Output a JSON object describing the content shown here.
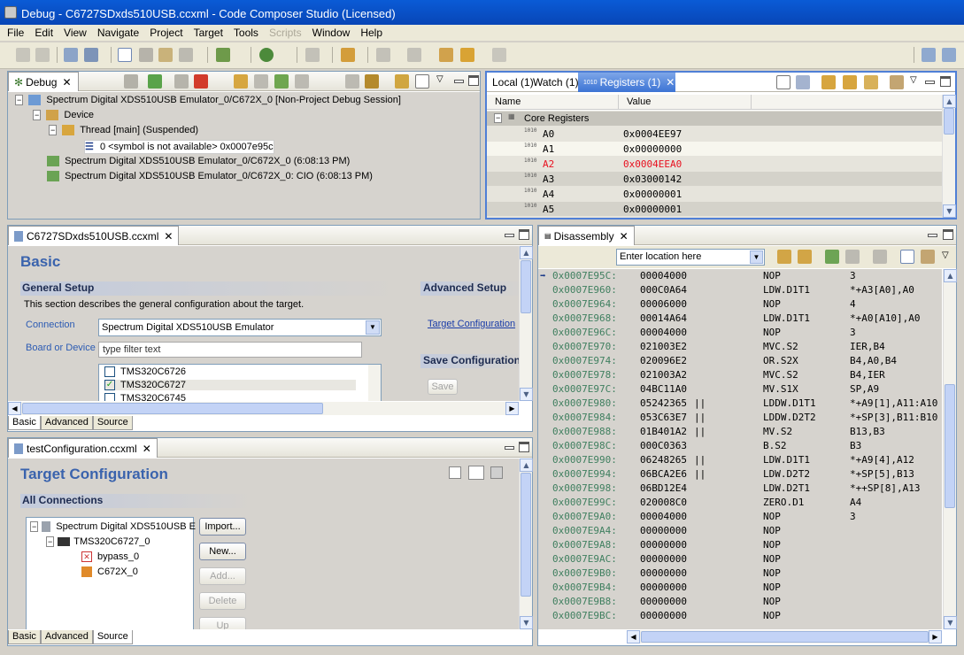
{
  "window": {
    "title": "Debug - C6727SDxds510USB.ccxml - Code Composer Studio (Licensed)"
  },
  "menu": [
    "File",
    "Edit",
    "View",
    "Navigate",
    "Project",
    "Target",
    "Tools",
    "Scripts",
    "Window",
    "Help"
  ],
  "debug_view": {
    "tab": "Debug",
    "items": [
      "Spectrum Digital XDS510USB Emulator_0/C672X_0 [Non-Project Debug Session]",
      "Device",
      "Thread [main] (Suspended)",
      "0 <symbol is not available> 0x0007e95c",
      "Spectrum Digital XDS510USB Emulator_0/C672X_0 (6:08:13 PM)",
      "Spectrum Digital XDS510USB Emulator_0/C672X_0: CIO (6:08:13 PM)"
    ]
  },
  "registers_view": {
    "tabs": [
      "Local (1)",
      "Watch (1)",
      "Registers (1)"
    ],
    "col_name": "Name",
    "col_value": "Value",
    "group": "Core Registers",
    "rows": [
      {
        "name": "A0",
        "value": "0x0004EE97",
        "changed": false
      },
      {
        "name": "A1",
        "value": "0x00000000",
        "changed": false
      },
      {
        "name": "A2",
        "value": "0x0004EEA0",
        "changed": true
      },
      {
        "name": "A3",
        "value": "0x03000142",
        "changed": false
      },
      {
        "name": "A4",
        "value": "0x00000001",
        "changed": false
      },
      {
        "name": "A5",
        "value": "0x00000001",
        "changed": false
      }
    ]
  },
  "ccxml_editor": {
    "tab": "C6727SDxds510USB.ccxml",
    "heading": "Basic",
    "general_setup": "General Setup",
    "general_desc": "This section describes the general configuration about the target.",
    "connection_label": "Connection",
    "connection_value": "Spectrum Digital XDS510USB Emulator",
    "board_label": "Board or Device",
    "filter_placeholder": "type filter text",
    "devices": [
      {
        "name": "TMS320C6726",
        "checked": false
      },
      {
        "name": "TMS320C6727",
        "checked": true
      },
      {
        "name": "TMS320C6745",
        "checked": false
      }
    ],
    "advanced_setup": "Advanced Setup",
    "target_config_link": "Target Configuration",
    "save_config": "Save Configuration",
    "save_button": "Save",
    "bottom_tabs": [
      "Basic",
      "Advanced",
      "Source"
    ]
  },
  "test_config": {
    "tab": "testConfiguration.ccxml",
    "heading": "Target Configuration",
    "all_connections": "All Connections",
    "tree": [
      "Spectrum Digital XDS510USB E",
      "TMS320C6727_0",
      "bypass_0",
      "C672X_0"
    ],
    "buttons": [
      "Import...",
      "New...",
      "Add...",
      "Delete",
      "Up"
    ],
    "bottom_tabs": [
      "Basic",
      "Advanced",
      "Source"
    ]
  },
  "disassembly": {
    "tab": "Disassembly",
    "location_placeholder": "Enter location here",
    "rows": [
      {
        "addr": "0x0007E95C:",
        "code": "00004000",
        "par": "",
        "op": "NOP",
        "args": "3",
        "current": true
      },
      {
        "addr": "0x0007E960:",
        "code": "000C0A64",
        "par": "",
        "op": "LDW.D1T1",
        "args": "*+A3[A0],A0"
      },
      {
        "addr": "0x0007E964:",
        "code": "00006000",
        "par": "",
        "op": "NOP",
        "args": "4"
      },
      {
        "addr": "0x0007E968:",
        "code": "00014A64",
        "par": "",
        "op": "LDW.D1T1",
        "args": "*+A0[A10],A0"
      },
      {
        "addr": "0x0007E96C:",
        "code": "00004000",
        "par": "",
        "op": "NOP",
        "args": "3"
      },
      {
        "addr": "0x0007E970:",
        "code": "021003E2",
        "par": "",
        "op": "MVC.S2",
        "args": "IER,B4"
      },
      {
        "addr": "0x0007E974:",
        "code": "020096E2",
        "par": "",
        "op": "OR.S2X",
        "args": "B4,A0,B4"
      },
      {
        "addr": "0x0007E978:",
        "code": "021003A2",
        "par": "",
        "op": "MVC.S2",
        "args": "B4,IER"
      },
      {
        "addr": "0x0007E97C:",
        "code": "04BC11A0",
        "par": "",
        "op": "MV.S1X",
        "args": "SP,A9"
      },
      {
        "addr": "0x0007E980:",
        "code": "05242365",
        "par": "||",
        "op": "LDDW.D1T1",
        "args": "*+A9[1],A11:A10"
      },
      {
        "addr": "0x0007E984:",
        "code": "053C63E7",
        "par": "||",
        "op": "LDDW.D2T2",
        "args": "*+SP[3],B11:B10"
      },
      {
        "addr": "0x0007E988:",
        "code": "01B401A2",
        "par": "||",
        "op": "MV.S2",
        "args": "B13,B3"
      },
      {
        "addr": "0x0007E98C:",
        "code": "000C0363",
        "par": "",
        "op": "B.S2",
        "args": "B3"
      },
      {
        "addr": "0x0007E990:",
        "code": "06248265",
        "par": "||",
        "op": "LDW.D1T1",
        "args": "*+A9[4],A12"
      },
      {
        "addr": "0x0007E994:",
        "code": "06BCA2E6",
        "par": "||",
        "op": "LDW.D2T2",
        "args": "*+SP[5],B13"
      },
      {
        "addr": "0x0007E998:",
        "code": "06BD12E4",
        "par": "",
        "op": "LDW.D2T1",
        "args": "*++SP[8],A13"
      },
      {
        "addr": "0x0007E99C:",
        "code": "020008C0",
        "par": "",
        "op": "ZERO.D1",
        "args": "A4"
      },
      {
        "addr": "0x0007E9A0:",
        "code": "00004000",
        "par": "",
        "op": "NOP",
        "args": "3"
      },
      {
        "addr": "0x0007E9A4:",
        "code": "00000000",
        "par": "",
        "op": "NOP",
        "args": ""
      },
      {
        "addr": "0x0007E9A8:",
        "code": "00000000",
        "par": "",
        "op": "NOP",
        "args": ""
      },
      {
        "addr": "0x0007E9AC:",
        "code": "00000000",
        "par": "",
        "op": "NOP",
        "args": ""
      },
      {
        "addr": "0x0007E9B0:",
        "code": "00000000",
        "par": "",
        "op": "NOP",
        "args": ""
      },
      {
        "addr": "0x0007E9B4:",
        "code": "00000000",
        "par": "",
        "op": "NOP",
        "args": ""
      },
      {
        "addr": "0x0007E9B8:",
        "code": "00000000",
        "par": "",
        "op": "NOP",
        "args": ""
      },
      {
        "addr": "0x0007E9BC:",
        "code": "00000000",
        "par": "",
        "op": "NOP",
        "args": ""
      }
    ]
  },
  "colors": {
    "title_bar": "#0a5bd6",
    "selected_tab": "#3c73d4",
    "changed_register": "#e8101f",
    "address": "#3f7f5f"
  }
}
